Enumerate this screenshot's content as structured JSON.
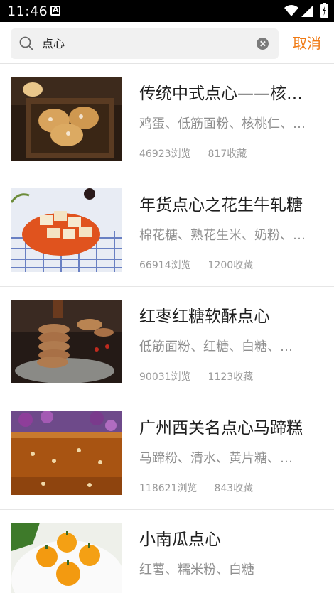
{
  "status_bar": {
    "time": "11:46"
  },
  "search": {
    "query": "点心",
    "cancel_label": "取消"
  },
  "colors": {
    "accent": "#f07a14",
    "title": "#1f1f1f",
    "meta": "#8f8f8f"
  },
  "results": [
    {
      "title": "传统中式点心——核桃酥",
      "ingredients": "鸡蛋、低筋面粉、核桃仁、…",
      "views": "46923浏览",
      "favorites": "817收藏"
    },
    {
      "title": "年货点心之花生牛轧糖",
      "ingredients": "棉花糖、熟花生米、奶粉、…",
      "views": "66914浏览",
      "favorites": "1200收藏"
    },
    {
      "title": "红枣红糖软酥点心",
      "ingredients": "低筋面粉、红糖、白糖、…",
      "views": "90031浏览",
      "favorites": "1123收藏"
    },
    {
      "title": "广州西关名点心马蹄糕",
      "ingredients": "马蹄粉、清水、黄片糖、…",
      "views": "118621浏览",
      "favorites": "843收藏"
    },
    {
      "title": "小南瓜点心",
      "ingredients": "红薯、糯米粉、白糖",
      "views": "",
      "favorites": ""
    }
  ]
}
